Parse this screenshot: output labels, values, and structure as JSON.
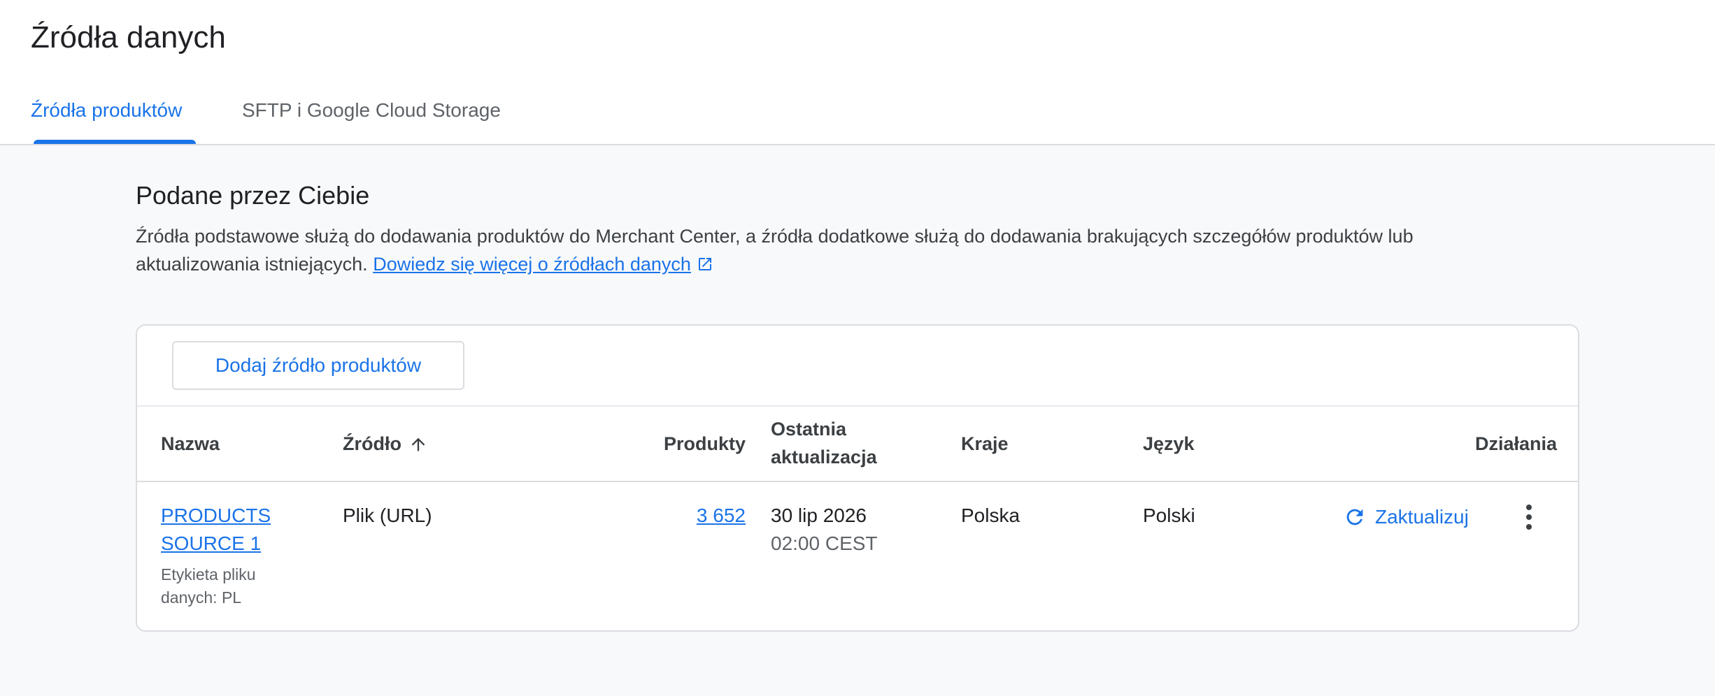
{
  "page": {
    "title": "Źródła danych"
  },
  "tabs": [
    {
      "label": "Źródła produktów",
      "active": true
    },
    {
      "label": "SFTP i Google Cloud Storage",
      "active": false
    }
  ],
  "section": {
    "title": "Podane przez Ciebie",
    "description_line1": "Źródła podstawowe służą do dodawania produktów do Merchant Center, a źródła dodatkowe służą do dodawania brakujących szczegółów produktów lub",
    "description_line2": "aktualizowania istniejących.",
    "learn_more": "Dowiedz się więcej o źródłach danych"
  },
  "card": {
    "add_button": "Dodaj źródło produktów"
  },
  "table": {
    "headers": {
      "name": "Nazwa",
      "source": "Źródło",
      "products": "Produkty",
      "last_update_1": "Ostatnia",
      "last_update_2": "aktualizacja",
      "countries": "Kraje",
      "language": "Język",
      "actions": "Działania"
    },
    "rows": [
      {
        "name_1": "PRODUCTS",
        "name_2": "SOURCE 1",
        "label_1": "Etykieta pliku",
        "label_2": "danych: PL",
        "source": "Plik (URL)",
        "products": "3 652",
        "date": "30 lip 2026",
        "time": "02:00 CEST",
        "countries": "Polska",
        "language": "Polski",
        "action_label": "Zaktualizuj"
      }
    ]
  },
  "colors": {
    "accent": "#1a73e8",
    "text": "#202124",
    "muted": "#5f6368",
    "background": "#f8f9fb"
  },
  "icons": [
    "sort-arrow-up-icon",
    "external-link-icon",
    "refresh-icon",
    "more-vert-icon"
  ]
}
